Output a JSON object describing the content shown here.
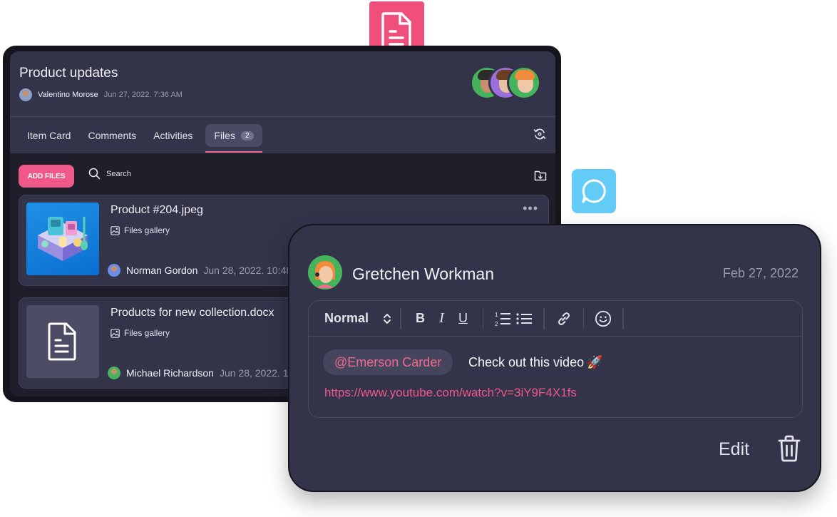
{
  "main": {
    "title": "Product updates",
    "author": "Valentino Morose",
    "date": "Jun 27, 2022. 7:36 AM",
    "tabs": [
      {
        "label": "Item Card"
      },
      {
        "label": "Comments"
      },
      {
        "label": "Activities"
      },
      {
        "label": "Files",
        "badge": "2"
      }
    ],
    "add_files_label": "ADD FILES",
    "search_label": "Search",
    "files": [
      {
        "name": "Product #204.jpeg",
        "gallery": "Files gallery",
        "owner": "Norman Gordon",
        "date": "Jun 28, 2022. 10:48"
      },
      {
        "name": "Products for new collection.docx",
        "gallery": "Files gallery",
        "owner": "Michael Richardson",
        "date": "Jun 28, 2022. 11"
      }
    ]
  },
  "comment": {
    "author": "Gretchen Workman",
    "date": "Feb 27, 2022",
    "format_select": "Normal",
    "mention": "@Emerson Carder",
    "message": "Check out this video",
    "link": "https://www.youtube.com/watch?v=3iY9F4X1fs",
    "edit_label": "Edit"
  },
  "colors": {
    "accent": "#f0588a",
    "card_bg": "#33334a",
    "chat_icon_bg": "#62ccf6"
  }
}
